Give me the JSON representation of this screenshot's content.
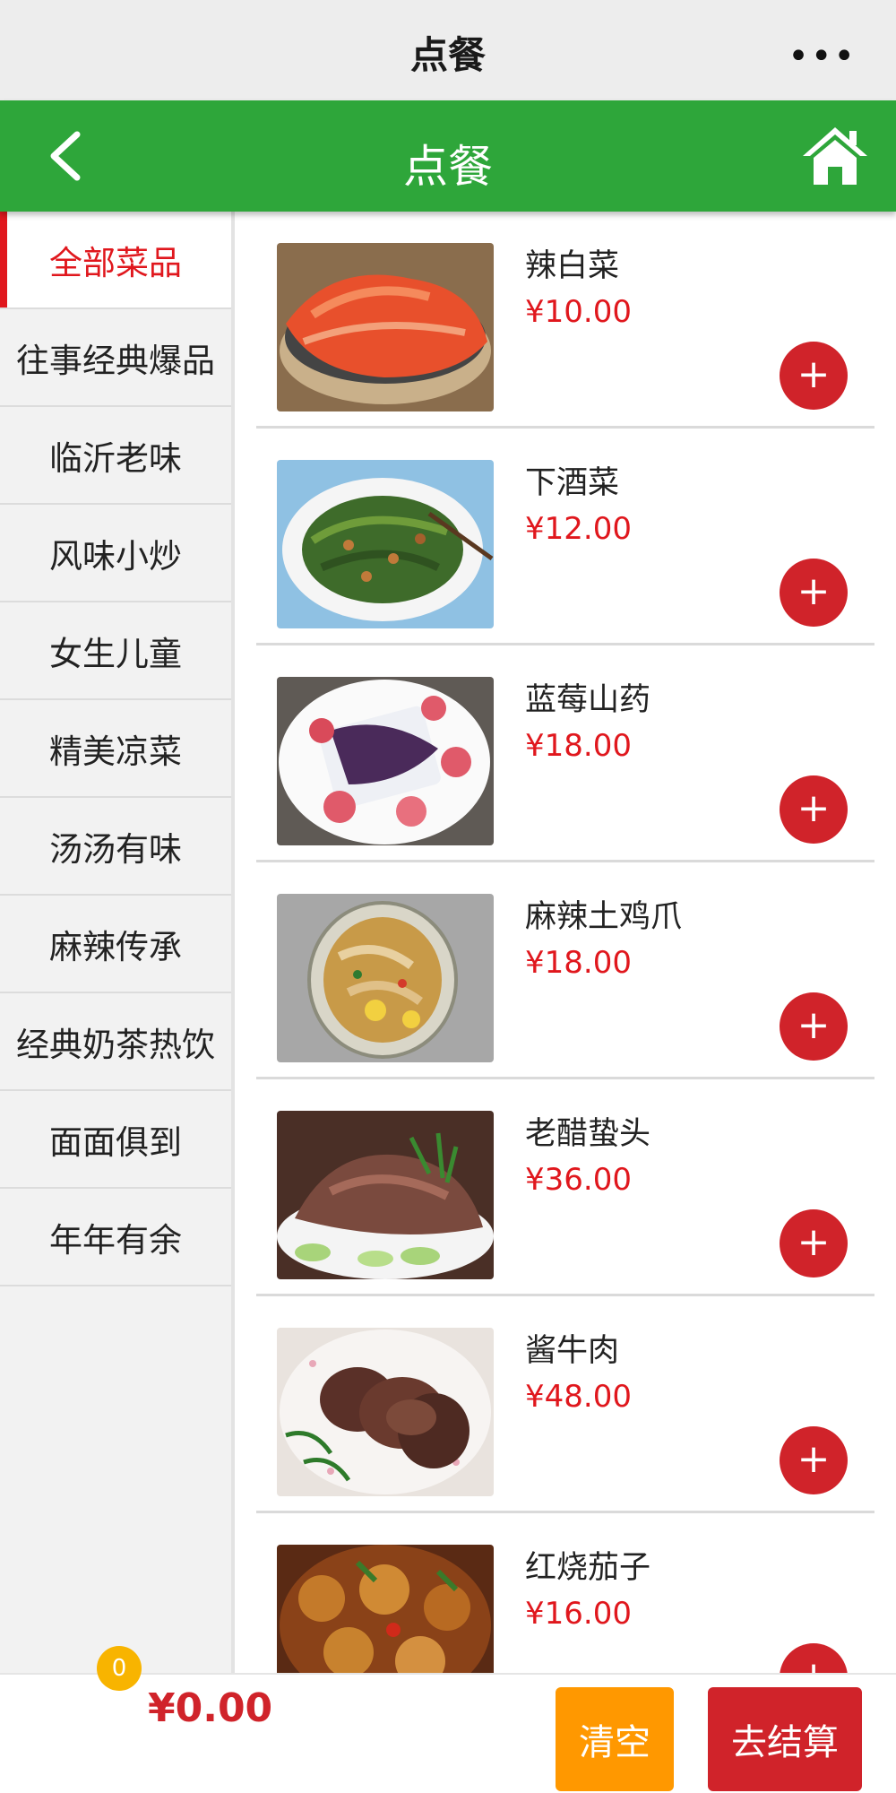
{
  "window": {
    "title": "点餐",
    "more_label": "•••"
  },
  "header": {
    "title": "点餐"
  },
  "sidebar": {
    "items": [
      {
        "label": "全部菜品",
        "active": true
      },
      {
        "label": "往事经典爆品"
      },
      {
        "label": "临沂老味"
      },
      {
        "label": "风味小炒"
      },
      {
        "label": "女生儿童"
      },
      {
        "label": "精美凉菜"
      },
      {
        "label": "汤汤有味"
      },
      {
        "label": "麻辣传承"
      },
      {
        "label": "经典奶茶热饮"
      },
      {
        "label": "面面俱到"
      },
      {
        "label": "年年有余"
      }
    ]
  },
  "dishes": [
    {
      "name": "辣白菜",
      "price": "¥10.00"
    },
    {
      "name": "下酒菜",
      "price": "¥12.00"
    },
    {
      "name": "蓝莓山药",
      "price": "¥18.00"
    },
    {
      "name": "麻辣土鸡爪",
      "price": "¥18.00"
    },
    {
      "name": "老醋蛰头",
      "price": "¥36.00"
    },
    {
      "name": "酱牛肉",
      "price": "¥48.00"
    },
    {
      "name": "红烧茄子",
      "price": "¥16.00"
    }
  ],
  "add_button_label": "+",
  "cart": {
    "count": "0",
    "total": "¥0.00"
  },
  "buttons": {
    "clear": "清空",
    "checkout": "去结算"
  },
  "colors": {
    "header_green": "#2ea63a",
    "accent_red": "#d0232a",
    "clear_orange": "#ff9800",
    "badge_yellow": "#f8b400"
  }
}
